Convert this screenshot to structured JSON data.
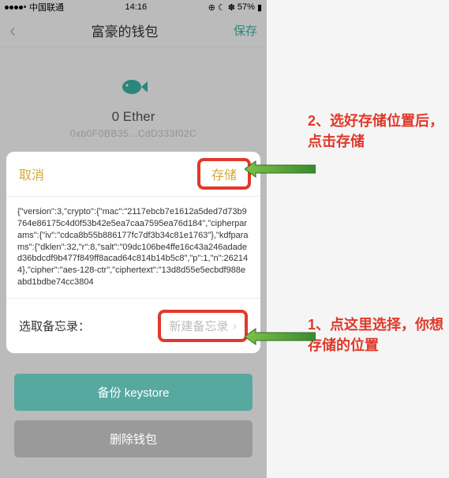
{
  "status": {
    "carrier": "中国联通",
    "time": "14:16",
    "battery": "57%"
  },
  "nav": {
    "title": "富豪的钱包",
    "save": "保存"
  },
  "wallet": {
    "balance": "0 Ether",
    "address": "0xb0F0BB35...CdD333f02C"
  },
  "sheet": {
    "cancel": "取消",
    "store": "存储",
    "json_text": "{\"version\":3,\"crypto\":{\"mac\":\"2117ebcb7e1612a5ded7d73b9764e86175c4d0f53b42e5ea7caa7595ea76d184\",\"cipherparams\":{\"iv\":\"cdca8b55b886177fc7df3b34c81e1763\"},\"kdfparams\":{\"dklen\":32,\"r\":8,\"salt\":\"09dc106be4ffe16c43a246adaded36bdcdf9b477f849ff8acad64c814b14b5c8\",\"p\":1,\"n\":262144},\"cipher\":\"aes-128-ctr\",\"ciphertext\":\"13d8d55e5ecbdf988eabd1bdbe74cc3804",
    "memo_label": "选取备忘录：",
    "memo_button": "新建备忘录"
  },
  "buttons": {
    "backup": "备份 keystore",
    "delete": "删除钱包"
  },
  "annotations": {
    "a1": "2、选好存储位置后，点击存储",
    "a2": "1、点这里选择，你想存储的位置"
  }
}
